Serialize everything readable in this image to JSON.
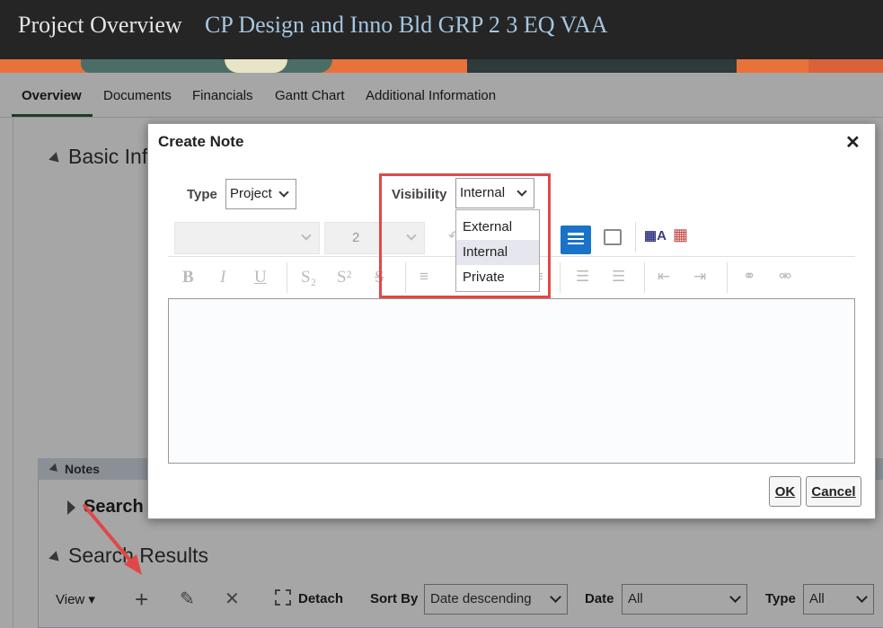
{
  "header": {
    "title": "Project Overview",
    "project_name": "CP Design and Inno Bld GRP 2 3 EQ VAA"
  },
  "tabs": [
    "Overview",
    "Documents",
    "Financials",
    "Gantt Chart",
    "Additional Information"
  ],
  "page": {
    "basic_info_title": "Basic Inf",
    "notes_title": "Notes",
    "search_label": "Search",
    "results_title": "Search Results",
    "toolbar": {
      "view_label": "View",
      "detach_label": "Detach",
      "sort_by_label": "Sort By",
      "sort_by_value": "Date descending",
      "date_label": "Date",
      "date_value": "All",
      "type_label": "Type",
      "type_value": "All"
    }
  },
  "dialog": {
    "title": "Create Note",
    "close_label": "✕",
    "type_label": "Type",
    "type_value": "Project",
    "visibility_label": "Visibility",
    "visibility_value": "Internal",
    "font_size_value": "2",
    "visibility_options": [
      "External",
      "Internal",
      "Private"
    ],
    "selected_option": "Internal",
    "ok_label": "OK",
    "cancel_label": "Cancel"
  },
  "colors": {
    "header_bg": "#252525",
    "header_project_text": "#a6c6e0",
    "annotation_red": "#e04848",
    "active_tab_underline": "#2b5d3f",
    "rte_active_icon": "#1a73c8"
  }
}
